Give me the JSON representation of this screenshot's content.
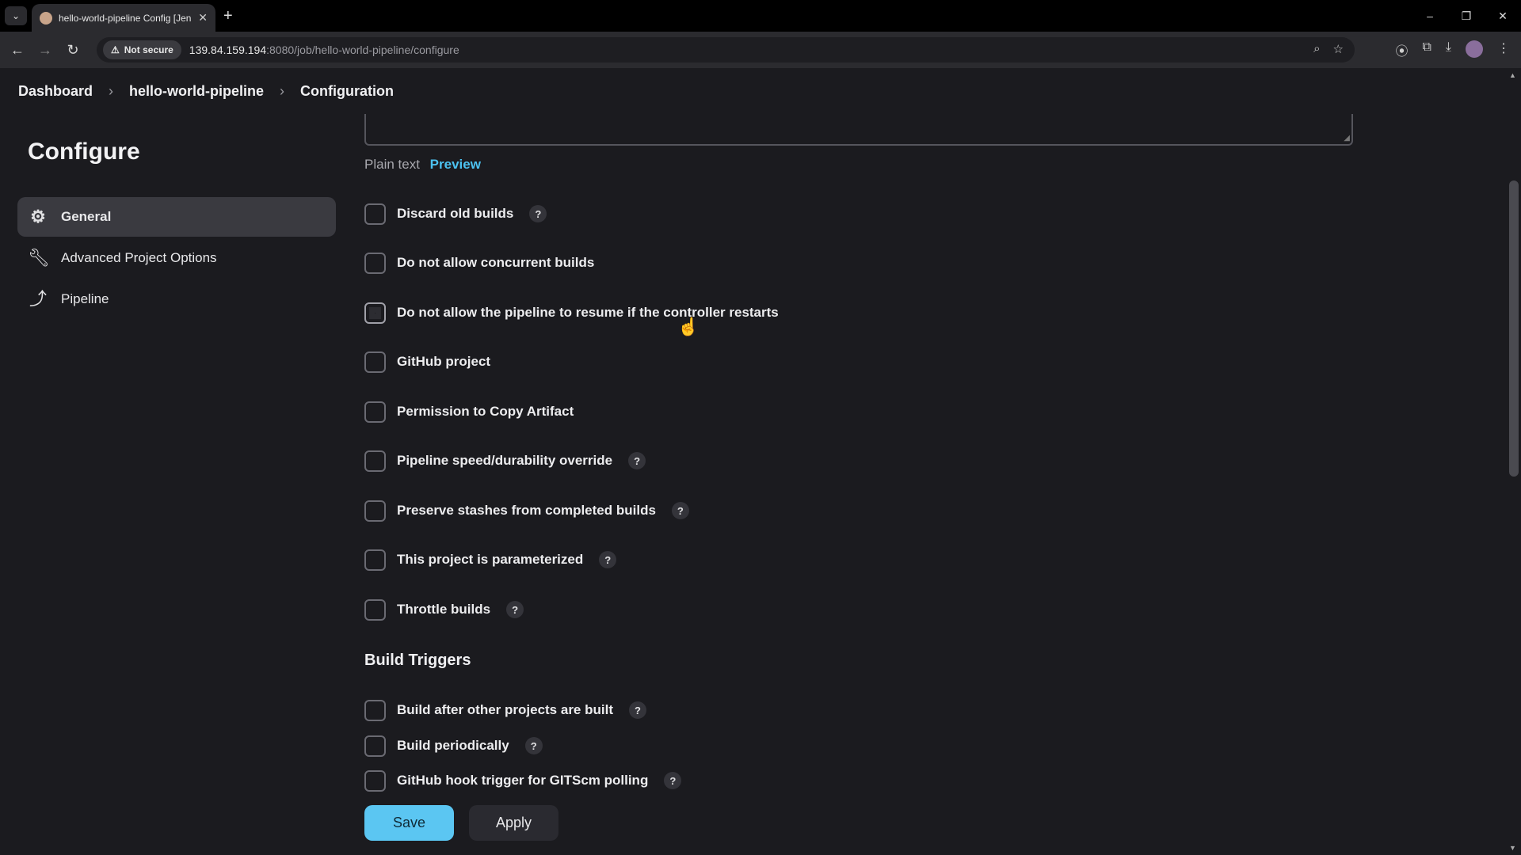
{
  "browser": {
    "tab_title": "hello-world-pipeline Config [Jenkins]",
    "security_label": "Not secure",
    "url_host": "139.84.159.194",
    "url_rest": ":8080/job/hello-world-pipeline/configure"
  },
  "breadcrumb": [
    "Dashboard",
    "hello-world-pipeline",
    "Configuration"
  ],
  "sidebar": {
    "title": "Configure",
    "items": [
      {
        "label": "General",
        "icon": "gear-icon",
        "active": true
      },
      {
        "label": "Advanced Project Options",
        "icon": "wrench-icon",
        "active": false
      },
      {
        "label": "Pipeline",
        "icon": "pipeline-icon",
        "active": false
      }
    ]
  },
  "description": {
    "plain_text": "Plain text",
    "preview": "Preview"
  },
  "options": [
    {
      "label": "Discard old builds",
      "checked": false,
      "help": true
    },
    {
      "label": "Do not allow concurrent builds",
      "checked": false,
      "help": false
    },
    {
      "label": "Do not allow the pipeline to resume if the controller restarts",
      "checked": false,
      "help": false
    },
    {
      "label": "GitHub project",
      "checked": false,
      "help": false
    },
    {
      "label": "Permission to Copy Artifact",
      "checked": false,
      "help": false
    },
    {
      "label": "Pipeline speed/durability override",
      "checked": false,
      "help": true
    },
    {
      "label": "Preserve stashes from completed builds",
      "checked": false,
      "help": true
    },
    {
      "label": "This project is parameterized",
      "checked": false,
      "help": true
    },
    {
      "label": "Throttle builds",
      "checked": false,
      "help": true
    }
  ],
  "build_triggers": {
    "heading": "Build Triggers",
    "options": [
      {
        "label": "Build after other projects are built",
        "checked": false,
        "help": true
      },
      {
        "label": "Build periodically",
        "checked": false,
        "help": true
      },
      {
        "label": "GitHub hook trigger for GITScm polling",
        "checked": false,
        "help": true
      }
    ]
  },
  "buttons": {
    "save": "Save",
    "apply": "Apply"
  },
  "help_glyph": "?",
  "colors": {
    "accent": "#5bc6f2",
    "link": "#4cc2f0",
    "background": "#1b1b1f"
  }
}
